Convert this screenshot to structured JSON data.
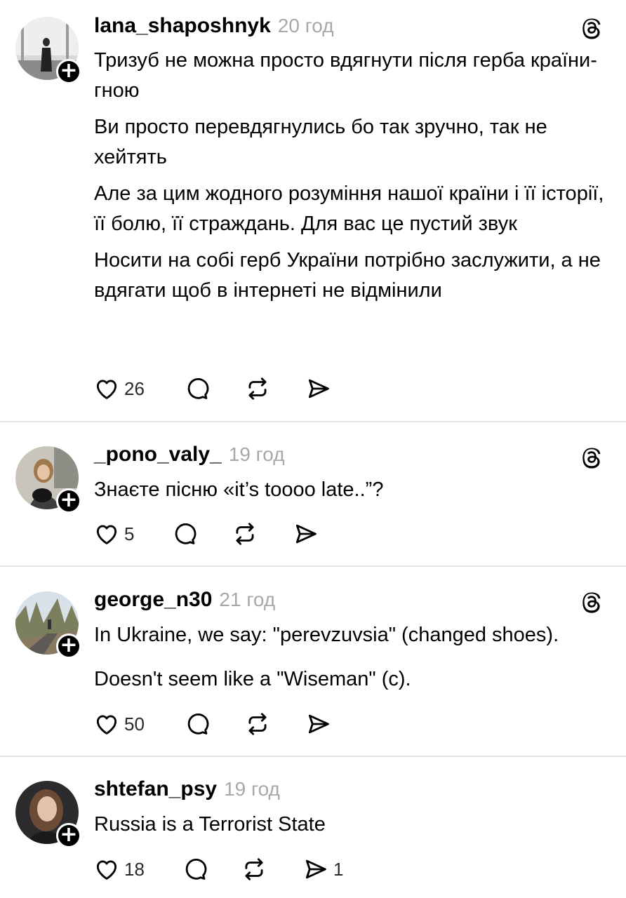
{
  "posts": [
    {
      "username": "lana_shaposhnyk",
      "time": "20 год",
      "paragraphs": [
        "Тризуб не можна просто вдягнути після герба країни-гною",
        "Ви просто перевдягнулись бо так зручно, так не хейтять",
        "Але за цим жодного розуміння нашої країни і її історії, її болю, її страждань. Для вас це пустий звук",
        "Носити на собі герб України потрібно заслужити, а не вдягати щоб в інтернеті не відмінили"
      ],
      "likes": "26",
      "shares": ""
    },
    {
      "username": "_pono_valy_",
      "time": "19 год",
      "paragraphs": [
        "Знаєте пісню «it’s toooo late..”?"
      ],
      "likes": "5",
      "shares": ""
    },
    {
      "username": "george_n30",
      "time": "21 год",
      "paragraphs": [
        "In Ukraine, we say: \"perevzuvsia\" (changed shoes).",
        "Doesn't seem like a \"Wiseman\" (c)."
      ],
      "likes": "50",
      "shares": ""
    },
    {
      "username": "shtefan_psy",
      "time": "19 год",
      "paragraphs": [
        "Russia is a Terrorist State"
      ],
      "likes": "18",
      "shares": "1"
    }
  ],
  "icons": {
    "like": "heart-icon",
    "reply": "comment-bubble-icon",
    "repost": "repost-icon",
    "share": "send-icon",
    "app": "threads-logo-icon",
    "follow": "plus-icon"
  },
  "colors": {
    "text": "#000000",
    "muted": "#a8a8a8",
    "divider": "#e4e4e4"
  }
}
